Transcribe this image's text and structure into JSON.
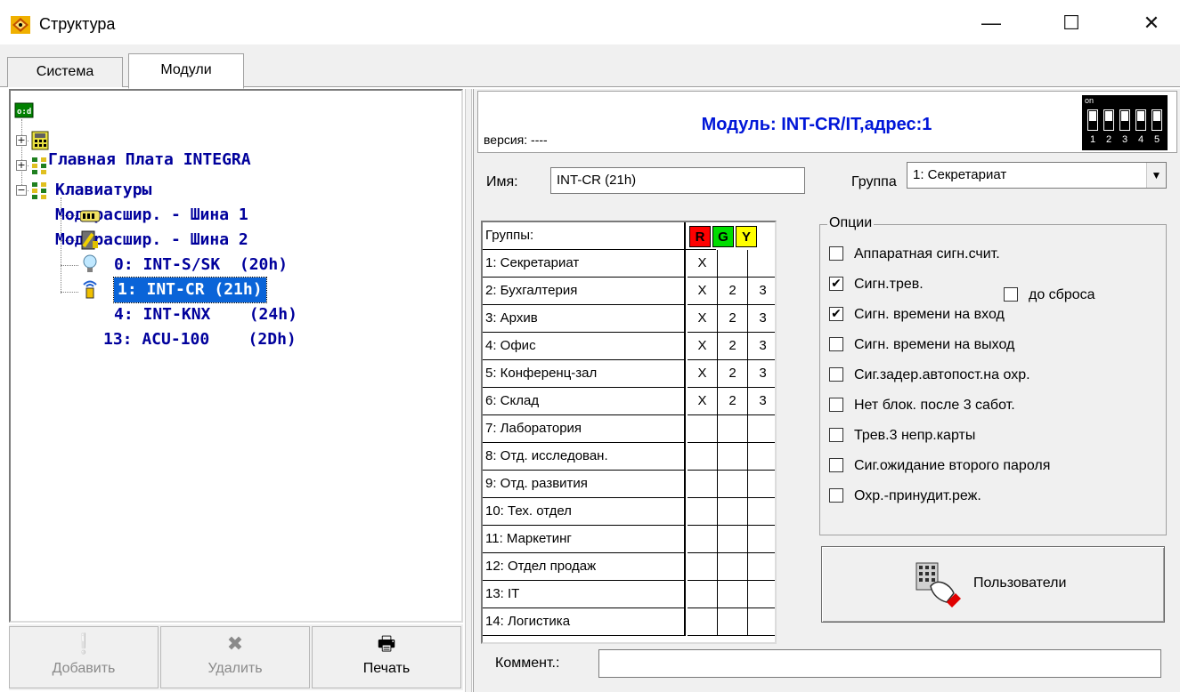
{
  "window": {
    "title": "Структура",
    "minimize": "—",
    "maximize": "☐",
    "close": "✕"
  },
  "tabs": [
    {
      "label": "Система",
      "active": false
    },
    {
      "label": "Модули",
      "active": true
    }
  ],
  "tree": {
    "root": "Главная Плата INTEGRA",
    "keypads": "Клавиатуры",
    "bus1": "Мод.расшир. - Шина 1",
    "bus2": "Мод.расшир. - Шина 2",
    "children": [
      {
        "label": "0: INT-S/SK  (20h)",
        "icon": "keypad-icon"
      },
      {
        "label": "1: INT-CR (21h)",
        "icon": "proximity-reader-icon",
        "selected": true
      },
      {
        "label": "4: INT-KNX    (24h)",
        "icon": "bulb-icon"
      },
      {
        "label": "13: ACU-100    (2Dh)",
        "icon": "wireless-controller-icon"
      }
    ]
  },
  "left_buttons": {
    "add": "Добавить",
    "delete": "Удалить",
    "print": "Печать"
  },
  "module": {
    "version_label": "версия: ----",
    "title": "Модуль: INT-CR/IT,адрес:1",
    "dip": {
      "on_label": "on",
      "switches": [
        "1",
        "2",
        "3",
        "4",
        "5"
      ]
    },
    "name_label": "Имя:",
    "name_value": "INT-CR (21h)",
    "group_label": "Группа",
    "group_value": "1: Секретариат"
  },
  "groups_table": {
    "header": "Группы:",
    "flags": [
      "R",
      "G",
      "Y"
    ],
    "flag_colors": [
      "#ff0000",
      "#00dd00",
      "#ffff00"
    ],
    "rows": [
      {
        "name": "1: Секретариат",
        "r": "X",
        "g": "",
        "y": ""
      },
      {
        "name": "2: Бухгалтерия",
        "r": "X",
        "g": "2",
        "y": "3"
      },
      {
        "name": "3: Архив",
        "r": "X",
        "g": "2",
        "y": "3"
      },
      {
        "name": "4: Офис",
        "r": "X",
        "g": "2",
        "y": "3"
      },
      {
        "name": "5: Конференц-зал",
        "r": "X",
        "g": "2",
        "y": "3"
      },
      {
        "name": "6: Склад",
        "r": "X",
        "g": "2",
        "y": "3"
      },
      {
        "name": "7: Лаборатория",
        "r": "",
        "g": "",
        "y": ""
      },
      {
        "name": "8: Отд. исследован.",
        "r": "",
        "g": "",
        "y": ""
      },
      {
        "name": "9: Отд. развития",
        "r": "",
        "g": "",
        "y": ""
      },
      {
        "name": "10: Тех. отдел",
        "r": "",
        "g": "",
        "y": ""
      },
      {
        "name": "11: Маркетинг",
        "r": "",
        "g": "",
        "y": ""
      },
      {
        "name": "12: Отдел продаж",
        "r": "",
        "g": "",
        "y": ""
      },
      {
        "name": "13: IT",
        "r": "",
        "g": "",
        "y": ""
      },
      {
        "name": "14: Логистика",
        "r": "",
        "g": "",
        "y": ""
      }
    ]
  },
  "options": {
    "title": "Опции",
    "items": [
      {
        "label": "Аппаратная сигн.счит.",
        "checked": false
      },
      {
        "label": "Сигн.трев.",
        "checked": true
      },
      {
        "label": "Сигн. времени на вход",
        "checked": true
      },
      {
        "label": "Сигн. времени на выход",
        "checked": false
      },
      {
        "label": "Сиг.задер.автопост.на охр.",
        "checked": false
      },
      {
        "label": "Нет блок. после 3 сабот.",
        "checked": false
      },
      {
        "label": "Трев.3 непр.карты",
        "checked": false
      },
      {
        "label": "Сиг.ожидание второго пароля",
        "checked": false
      },
      {
        "label": "Охр.-принудит.реж.",
        "checked": false
      }
    ],
    "until_reset": {
      "label": "до сброса",
      "checked": false
    }
  },
  "users_button": "Пользователи",
  "comment": {
    "label": "Коммент.:",
    "value": ""
  },
  "colors": {
    "tree_text": "#00009c",
    "title_blue": "#0016d8",
    "selection": "#0a64d8"
  }
}
